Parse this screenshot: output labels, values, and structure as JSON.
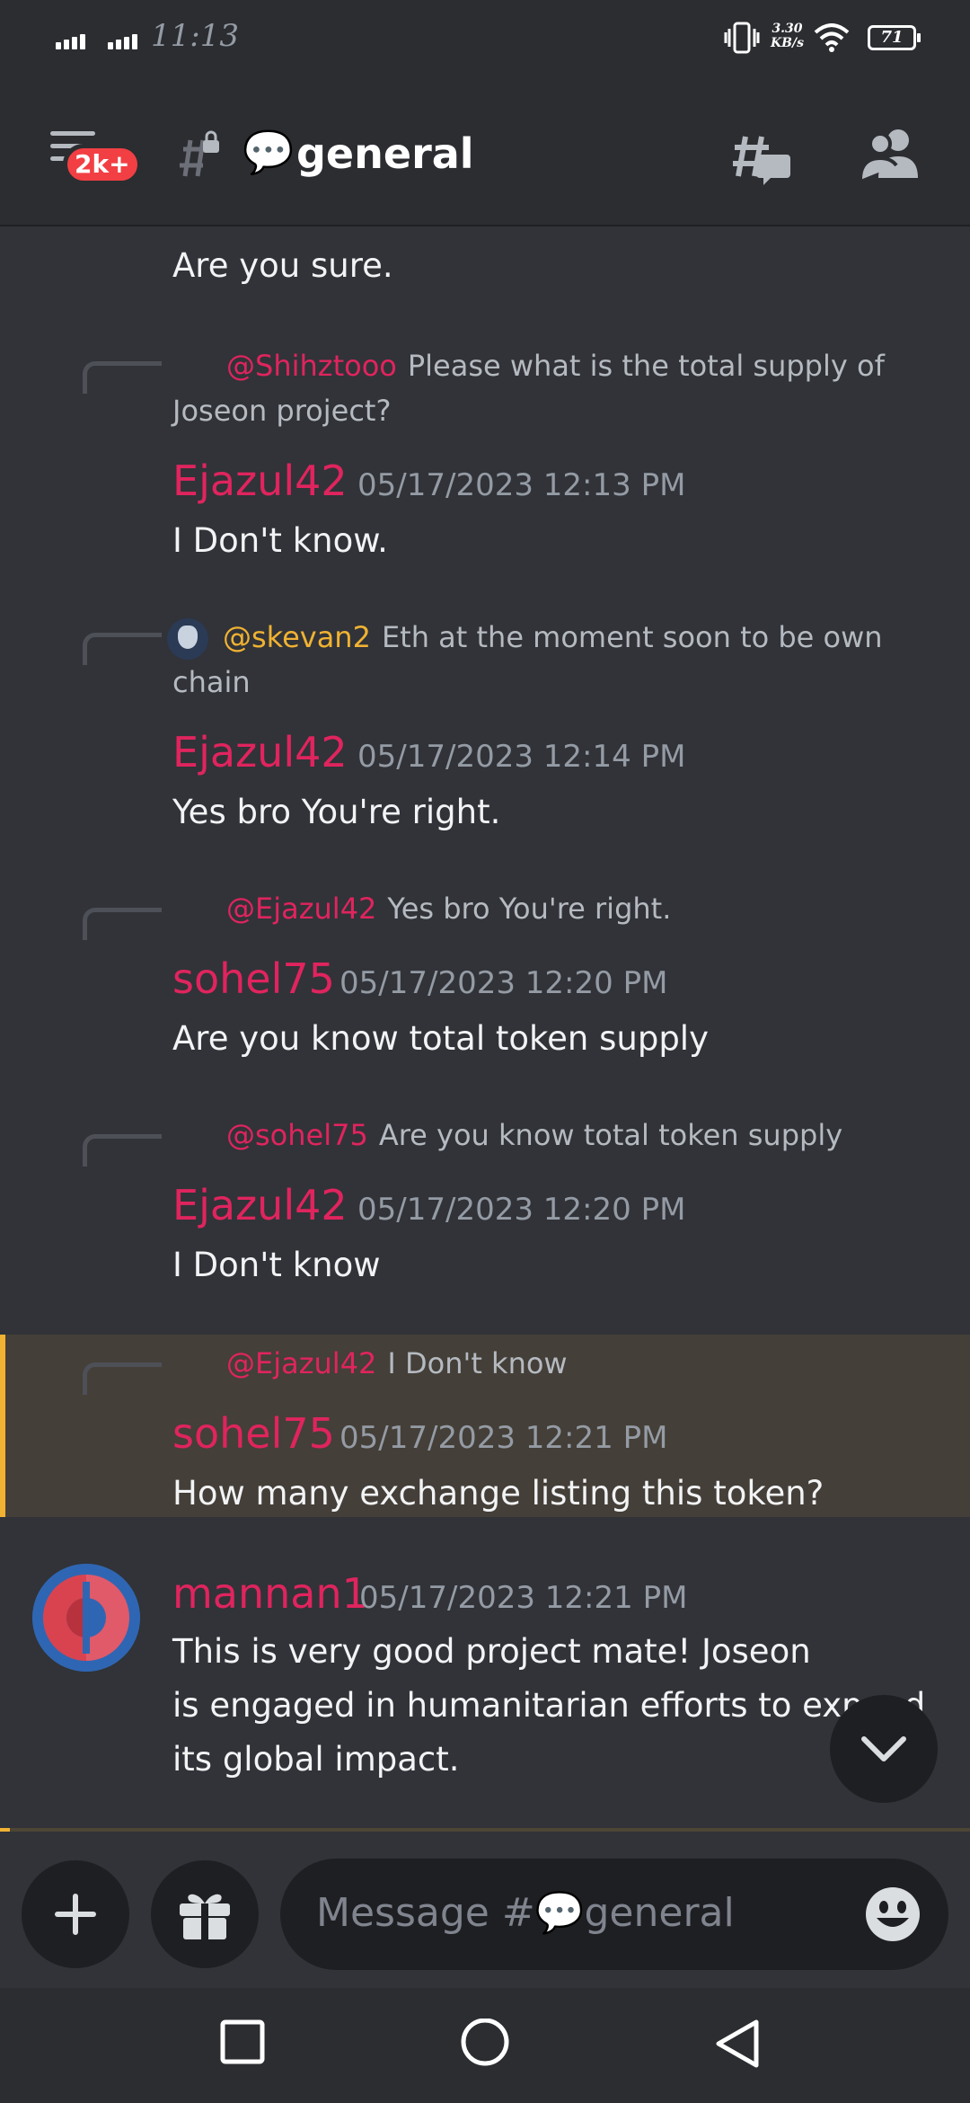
{
  "status_bar": {
    "time": "11:13",
    "net_speed_value": "3.30",
    "net_speed_unit": "KB/s",
    "battery": "71"
  },
  "header": {
    "badge": "2k+",
    "channel_emoji": "💬",
    "channel_name": "general"
  },
  "messages": [
    {
      "type": "continuation",
      "body": "Are you sure."
    },
    {
      "type": "reply",
      "reply": {
        "mention": "@Shihztooo",
        "mention_color": "#e0245e",
        "text": "Please what is the total supply of Joseon project?"
      },
      "author": "Ejazul42",
      "author_color": "#e0245e",
      "timestamp": "05/17/2023 12:13 PM",
      "body": "I Don't know."
    },
    {
      "type": "reply",
      "reply": {
        "mention": "@skevan2",
        "mention_color": "#f0b232",
        "text": "Eth at the moment soon to be own chain"
      },
      "author": "Ejazul42",
      "author_color": "#e0245e",
      "timestamp": "05/17/2023 12:14 PM",
      "body": "Yes bro You're right."
    },
    {
      "type": "reply",
      "reply": {
        "mention": "@Ejazul42",
        "mention_color": "#e0245e",
        "text": "Yes bro You're right."
      },
      "author": "sohel75",
      "author_color": "#e0245e",
      "timestamp": "05/17/2023 12:20 PM",
      "body": "Are you know total token supply"
    },
    {
      "type": "reply",
      "highlighted": true,
      "reply": {
        "mention": "@sohel75",
        "mention_color": "#e0245e",
        "text": "Are you know total token supply"
      },
      "author": "Ejazul42",
      "author_color": "#e0245e",
      "timestamp": "05/17/2023 12:20 PM",
      "body": "I Don't know"
    },
    {
      "type": "reply",
      "reply": {
        "mention": "@Ejazul42",
        "mention_color": "#e0245e",
        "text": "I Don't know"
      },
      "author": "sohel75",
      "author_color": "#e0245e",
      "timestamp": "05/17/2023 12:21 PM",
      "body": "How many exchange listing this token?"
    },
    {
      "type": "message",
      "author": "mannan1",
      "author_color": "#e0245e",
      "timestamp": "05/17/2023 12:21 PM",
      "body_lines": [
        "This is very good project mate! Joseon",
        "is engaged in humanitarian efforts to expand",
        "its global impact."
      ]
    }
  ],
  "composer": {
    "placeholder_prefix": "Message #",
    "placeholder_emoji": "💬",
    "placeholder_channel": "general"
  },
  "icons": {
    "menu": "hamburger-icon",
    "channel": "locked-hash-icon",
    "threads": "threads-icon",
    "members": "members-icon",
    "add": "plus-icon",
    "gift": "gift-icon",
    "emoji": "smiley-icon",
    "scroll": "chevron-down-icon",
    "nav_recents": "square-icon",
    "nav_home": "circle-icon",
    "nav_back": "triangle-back-icon"
  },
  "colors": {
    "background": "#313338",
    "header": "#2b2d31",
    "mention_red": "#e0245e",
    "mention_yellow": "#f0b232",
    "highlight_bg": "#443f38",
    "badge": "#f23f43"
  }
}
